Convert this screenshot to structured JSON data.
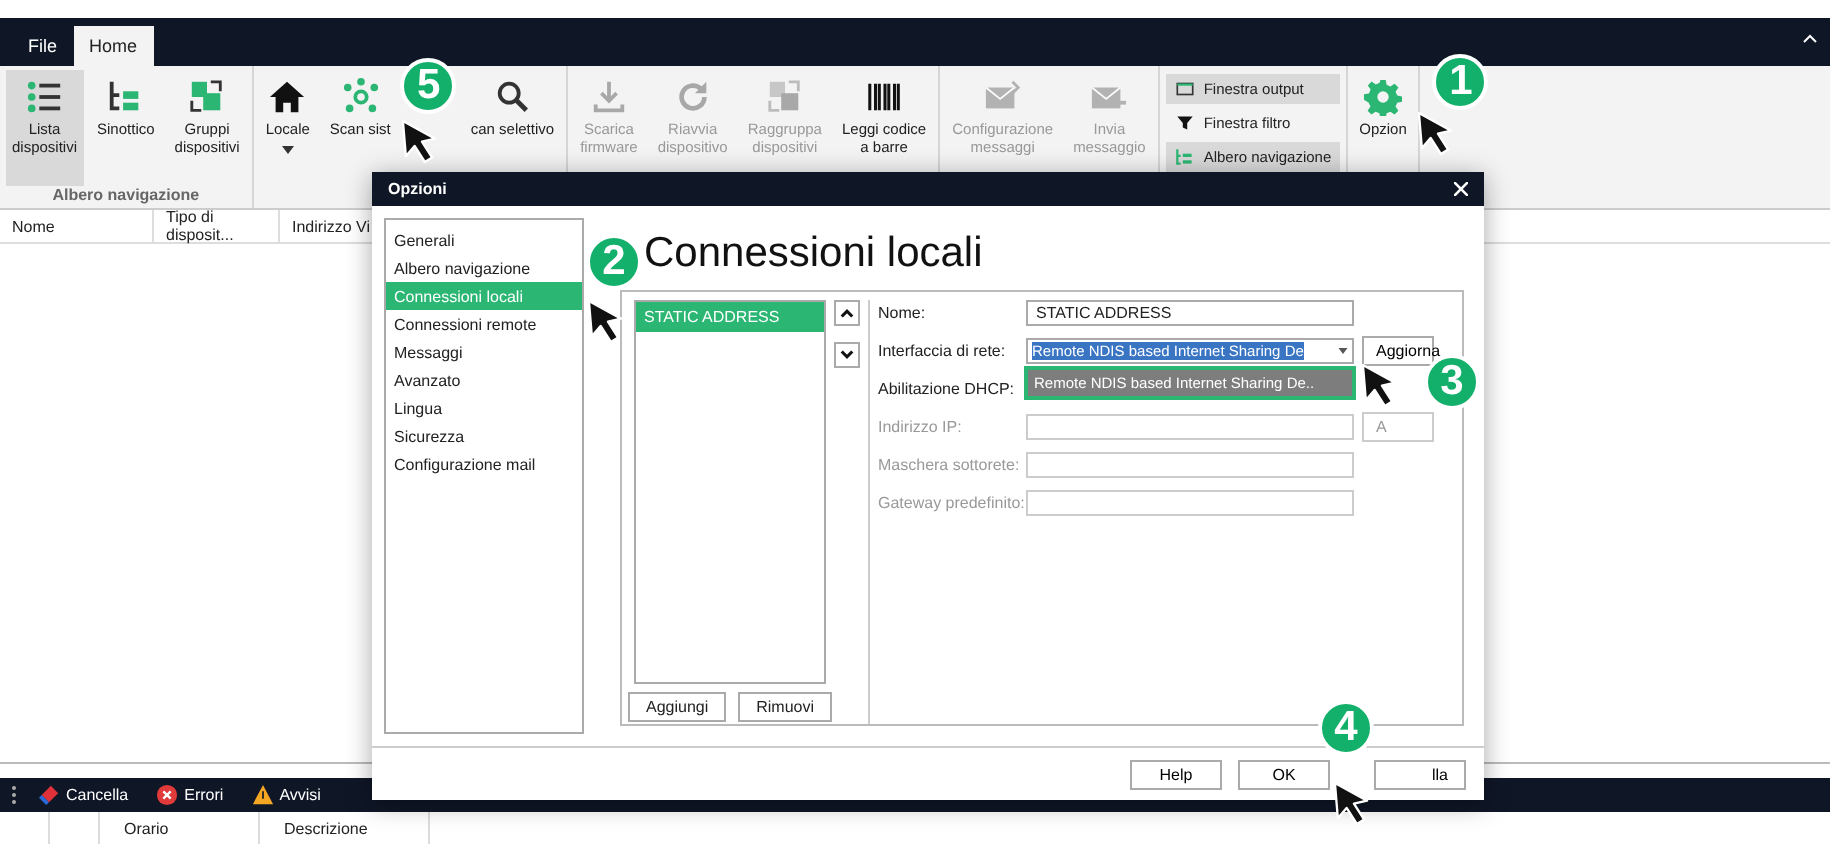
{
  "app_tabs": [
    {
      "label": "File",
      "selected": false
    },
    {
      "label": "Home",
      "selected": true
    }
  ],
  "ribbon_groups": [
    {
      "label": "Albero navigazione",
      "buttons": [
        {
          "kind": "large",
          "label": "Lista\ndispositivi",
          "selected": true,
          "disabled": false
        },
        {
          "kind": "large",
          "label": "Sinottico",
          "selected": false,
          "disabled": false
        },
        {
          "kind": "large",
          "label": "Gruppi\ndispositivi",
          "selected": false,
          "disabled": false
        }
      ]
    },
    {
      "buttons": [
        {
          "kind": "large",
          "label": "Locale",
          "caret": true,
          "selected": false,
          "disabled": false
        },
        {
          "kind": "large",
          "label": "Scan sist",
          "selected": false,
          "disabled": false
        },
        {
          "kind": "large",
          "label": "can selettivo",
          "selected": false,
          "disabled": false
        }
      ]
    },
    {
      "buttons": [
        {
          "kind": "large",
          "label": "Scarica\nfirmware",
          "selected": false,
          "disabled": true
        },
        {
          "kind": "large",
          "label": "Riavvia\ndispositivo",
          "selected": false,
          "disabled": true
        },
        {
          "kind": "large",
          "label": "Raggruppa\ndispositivi",
          "selected": false,
          "disabled": true
        },
        {
          "kind": "large",
          "label": "Leggi codice\na barre",
          "selected": false,
          "disabled": false
        }
      ]
    },
    {
      "buttons": [
        {
          "kind": "large",
          "label": "Configurazione\nmessaggi",
          "selected": false,
          "disabled": true
        },
        {
          "kind": "large",
          "label": "Invia\nmessaggio",
          "selected": false,
          "disabled": true
        }
      ]
    },
    {
      "buttons": [
        {
          "kind": "small",
          "label": "Finestra output",
          "selected": true,
          "disabled": false
        },
        {
          "kind": "small",
          "label": "Finestra filtro",
          "selected": false,
          "disabled": false
        },
        {
          "kind": "small",
          "label": "Albero navigazione",
          "selected": true,
          "disabled": false
        }
      ]
    },
    {
      "buttons": [
        {
          "kind": "large",
          "label": "Opzion",
          "selected": false,
          "disabled": false
        }
      ]
    }
  ],
  "device_columns": [
    "Nome",
    "Tipo di disposit...",
    "Indirizzo Vi"
  ],
  "log_toolbar": [
    "Cancella",
    "Errori",
    "Avvisi"
  ],
  "log_columns": [
    "Orario",
    "Descrizione"
  ],
  "dialog": {
    "title": "Opzioni",
    "nav_items": [
      {
        "label": "Generali",
        "selected": false
      },
      {
        "label": "Albero navigazione",
        "selected": false
      },
      {
        "label": "Connessioni locali",
        "selected": true
      },
      {
        "label": "Connessioni remote",
        "selected": false
      },
      {
        "label": "Messaggi",
        "selected": false
      },
      {
        "label": "Avanzato",
        "selected": false
      },
      {
        "label": "Lingua",
        "selected": false
      },
      {
        "label": "Sicurezza",
        "selected": false
      },
      {
        "label": "Configurazione mail",
        "selected": false
      }
    ],
    "heading": "Connessioni locali",
    "connections": [
      {
        "label": "STATIC ADDRESS",
        "selected": true
      }
    ],
    "list_buttons": [
      "Aggiungi",
      "Rimuovi"
    ],
    "fields": [
      {
        "kind": "text",
        "label": "Nome:",
        "value": "STATIC ADDRESS",
        "disabled": false
      },
      {
        "kind": "select",
        "label": "Interfaccia di rete:",
        "value": "Remote NDIS based Internet Sharing De",
        "disabled": false,
        "button": "Aggiorna",
        "options": [
          {
            "label": "Remote NDIS based Internet Sharing De..",
            "selected": true
          }
        ]
      },
      {
        "kind": "label",
        "label": "Abilitazione DHCP:",
        "disabled": false
      },
      {
        "kind": "text",
        "label": "Indirizzo IP:",
        "disabled": true,
        "button": "A"
      },
      {
        "kind": "text",
        "label": "Maschera sottorete:",
        "disabled": true
      },
      {
        "kind": "text",
        "label": "Gateway predefinito:",
        "disabled": true
      }
    ],
    "footer_buttons": [
      "Help",
      "OK",
      "lla"
    ]
  },
  "callouts": [
    "5",
    "1",
    "2",
    "3",
    "4"
  ]
}
